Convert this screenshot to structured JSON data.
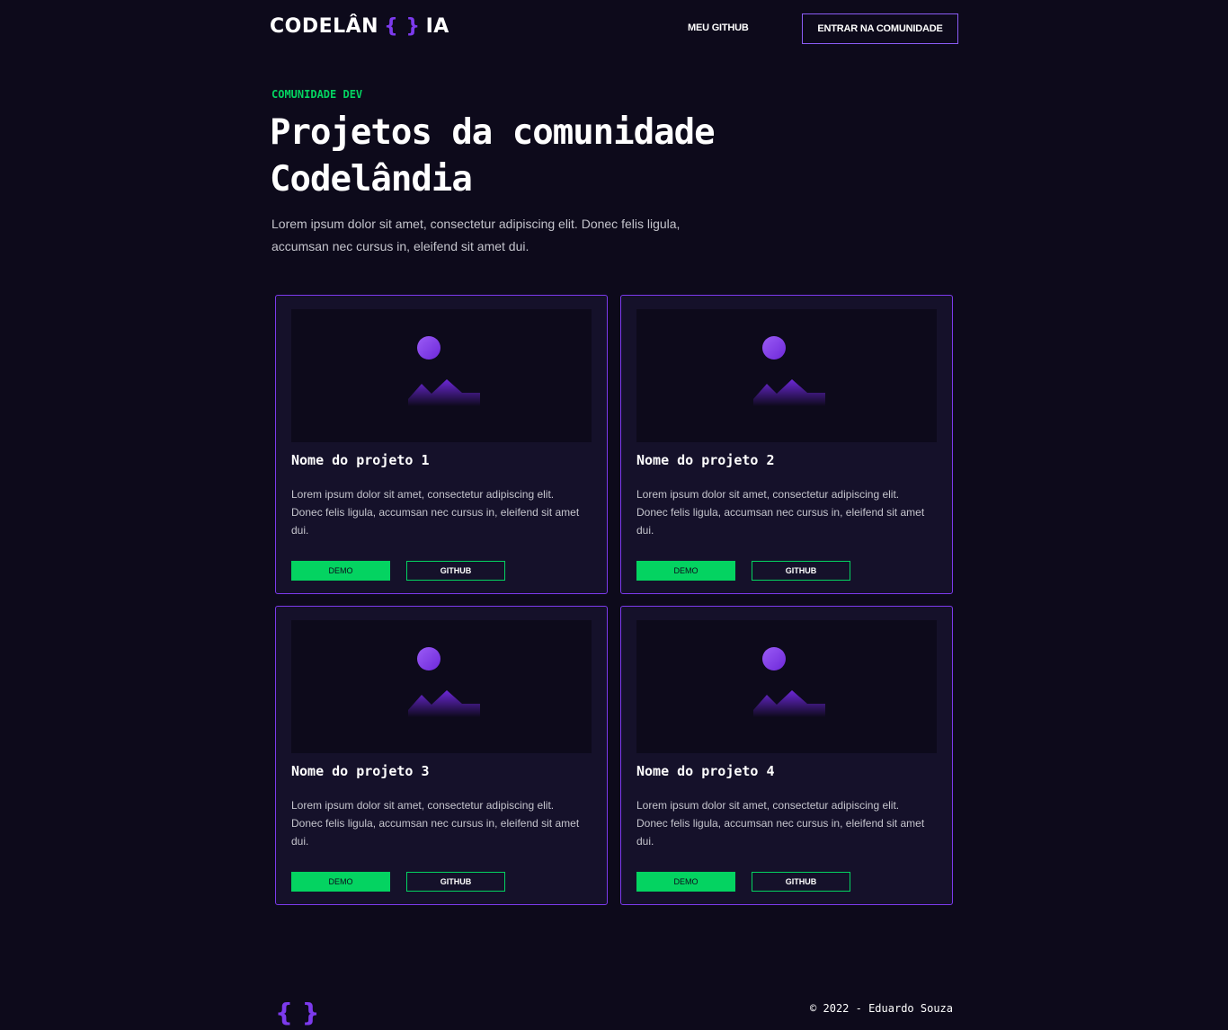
{
  "header": {
    "logo_prefix": "CODELÂN",
    "logo_braces": "{ }",
    "logo_suffix": "IA",
    "nav_github": "MEU GITHUB",
    "cta": "ENTRAR NA COMUNIDADE"
  },
  "hero": {
    "eyebrow": "COMUNIDADE DEV",
    "title": "Projetos da comunidade Codelândia",
    "description": "Lorem ipsum dolor sit amet, consectetur adipiscing elit. Donec felis ligula, accumsan nec cursus in, eleifend sit amet dui."
  },
  "projects": [
    {
      "title": "Nome do projeto 1",
      "description": "Lorem ipsum dolor sit amet, consectetur adipiscing elit. Donec felis ligula, accumsan nec cursus in, eleifend sit amet dui.",
      "demo_label": "DEMO",
      "github_label": "GITHUB",
      "image_icon": "image-placeholder-icon"
    },
    {
      "title": "Nome do projeto 2",
      "description": "Lorem ipsum dolor sit amet, consectetur adipiscing elit. Donec felis ligula, accumsan nec cursus in, eleifend sit amet dui.",
      "demo_label": "DEMO",
      "github_label": "GITHUB",
      "image_icon": "image-placeholder-icon"
    },
    {
      "title": "Nome do projeto 3",
      "description": "Lorem ipsum dolor sit amet, consectetur adipiscing elit. Donec felis ligula, accumsan nec cursus in, eleifend sit amet dui.",
      "demo_label": "DEMO",
      "github_label": "GITHUB",
      "image_icon": "image-placeholder-icon"
    },
    {
      "title": "Nome do projeto 4",
      "description": "Lorem ipsum dolor sit amet, consectetur adipiscing elit. Donec felis ligula, accumsan nec cursus in, eleifend sit amet dui.",
      "demo_label": "DEMO",
      "github_label": "GITHUB",
      "image_icon": "image-placeholder-icon"
    }
  ],
  "footer": {
    "logo": "{ }",
    "copyright": "© 2022 - Eduardo Souza"
  },
  "colors": {
    "background": "#0d0a1b",
    "card_background": "#15112a",
    "accent_purple": "#7c3aed",
    "accent_green": "#04d361",
    "text_muted": "#c4c4cc"
  }
}
